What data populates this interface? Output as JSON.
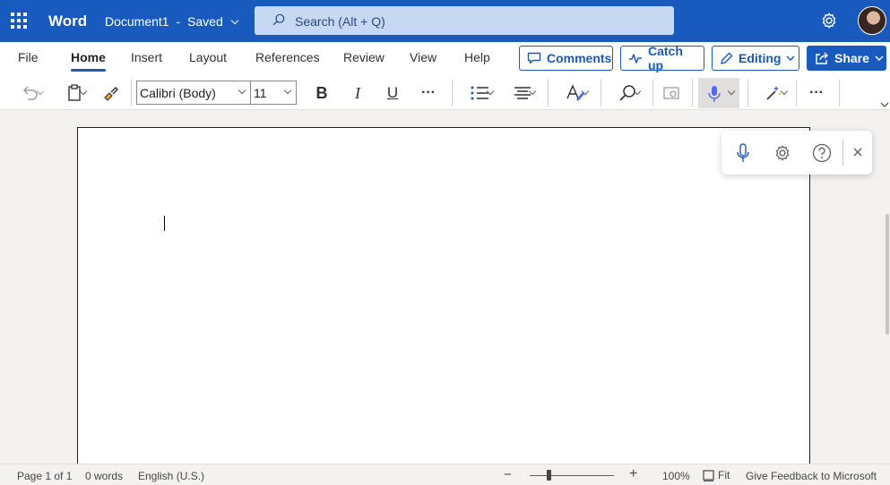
{
  "titlebar": {
    "app_name": "Word",
    "document_title": "Document1",
    "separator": "-",
    "save_status": "Saved",
    "search_placeholder": "Search (Alt + Q)",
    "brand_color": "#185abd"
  },
  "ribbon": {
    "tabs": [
      {
        "label": "File",
        "active": false
      },
      {
        "label": "Home",
        "active": true
      },
      {
        "label": "Insert",
        "active": false
      },
      {
        "label": "Layout",
        "active": false
      },
      {
        "label": "References",
        "active": false
      },
      {
        "label": "Review",
        "active": false
      },
      {
        "label": "View",
        "active": false
      },
      {
        "label": "Help",
        "active": false
      }
    ],
    "buttons": {
      "comments": "Comments",
      "catch_up": "Catch up",
      "editing": "Editing",
      "share": "Share"
    }
  },
  "toolbar": {
    "font_name": "Calibri (Body)",
    "font_size": "11",
    "bold": "B",
    "italic": "I",
    "underline": "U",
    "more": "···",
    "more2": "···"
  },
  "document": {
    "content": ""
  },
  "status": {
    "page": "Page 1 of 1",
    "words": "0 words",
    "language": "English (U.S.)",
    "zoom_minus": "−",
    "zoom_plus": "+",
    "zoom_level": "100%",
    "zoom_fraction": 0.5,
    "fit": "Fit",
    "feedback": "Give Feedback to Microsoft"
  }
}
